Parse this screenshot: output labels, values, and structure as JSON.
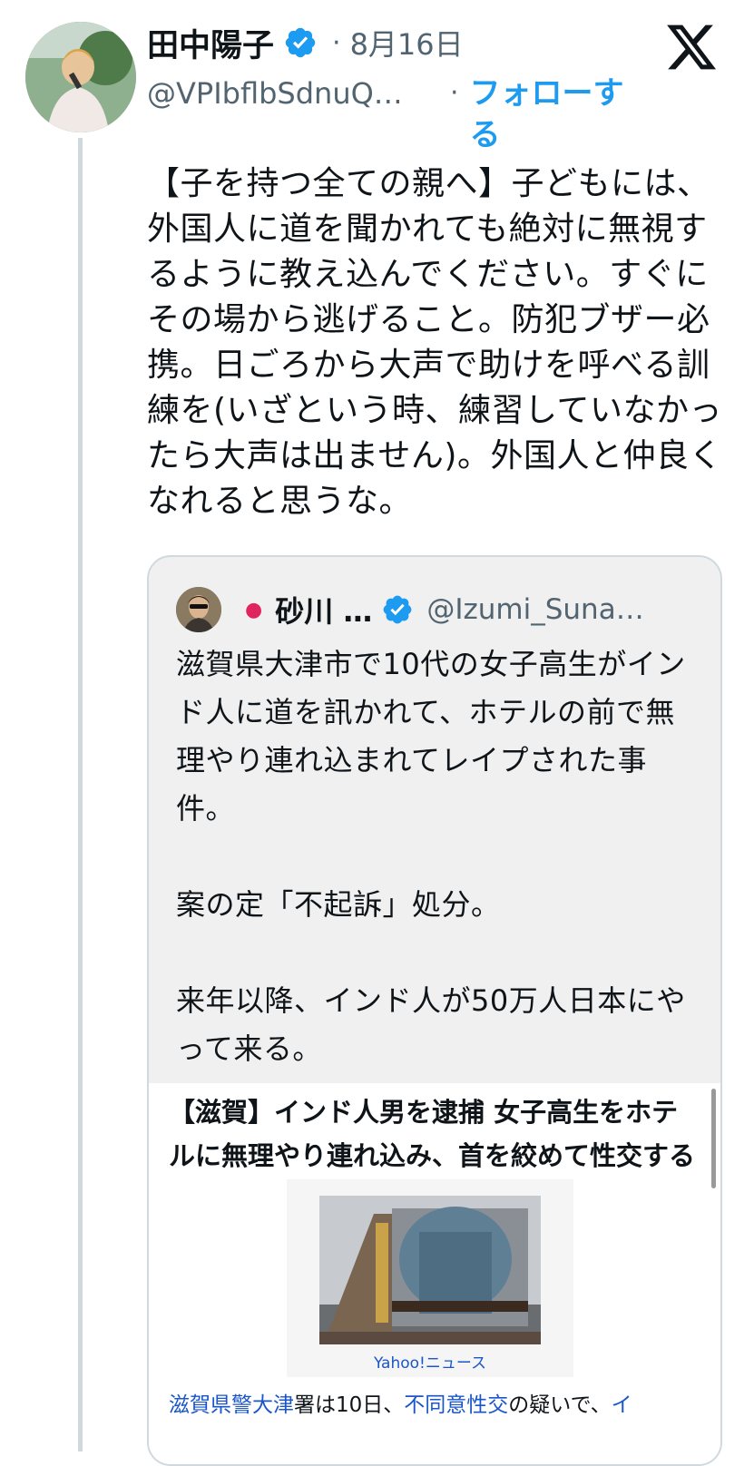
{
  "tweet": {
    "author_name": "田中陽子",
    "date": "8月16日",
    "handle": "@VPIbflbSdnuQ…",
    "follow_label": "フォローする",
    "text": "【子を持つ全ての親へ】子どもには、外国人に道を聞かれても絶対に無視するように教え込んでください。すぐにその場から逃げること。防犯ブザー必携。日ごろから大声で助けを呼べる訓練を(いざという時、練習していなかったら大声は出ません)。外国人と仲良くなれると思うな。",
    "separator": "·"
  },
  "quote": {
    "author_name": "砂川 …",
    "handle": "@Izumi_Suna…",
    "text": "滋賀県大津市で10代の女子高生がインド人に道を訊かれて、ホテルの前で無理やり連れ込まれてレイプされた事件。\n\n案の定「不起訴」処分。\n\n来年以降、インド人が50万人日本にやって来る。",
    "article": {
      "headline": "【滋賀】インド人男を逮捕 女子高生をホテルに無理やり連れ込み、首を絞めて性交する",
      "image_caption": "Yahoo!ニュース",
      "body_parts": [
        {
          "text": "滋賀県警大津",
          "link": true
        },
        {
          "text": "署は10日、",
          "link": false
        },
        {
          "text": "不同意性交",
          "link": true
        },
        {
          "text": "の疑いで、",
          "link": false
        },
        {
          "text": "イ",
          "link": true
        }
      ]
    }
  },
  "colors": {
    "accent": "#1d9bf0",
    "secondary_text": "#536471",
    "link": "#1a56c9",
    "border": "#cfd9de"
  },
  "icons": [
    "verified-badge-icon",
    "x-logo-icon",
    "red-dot-icon"
  ]
}
